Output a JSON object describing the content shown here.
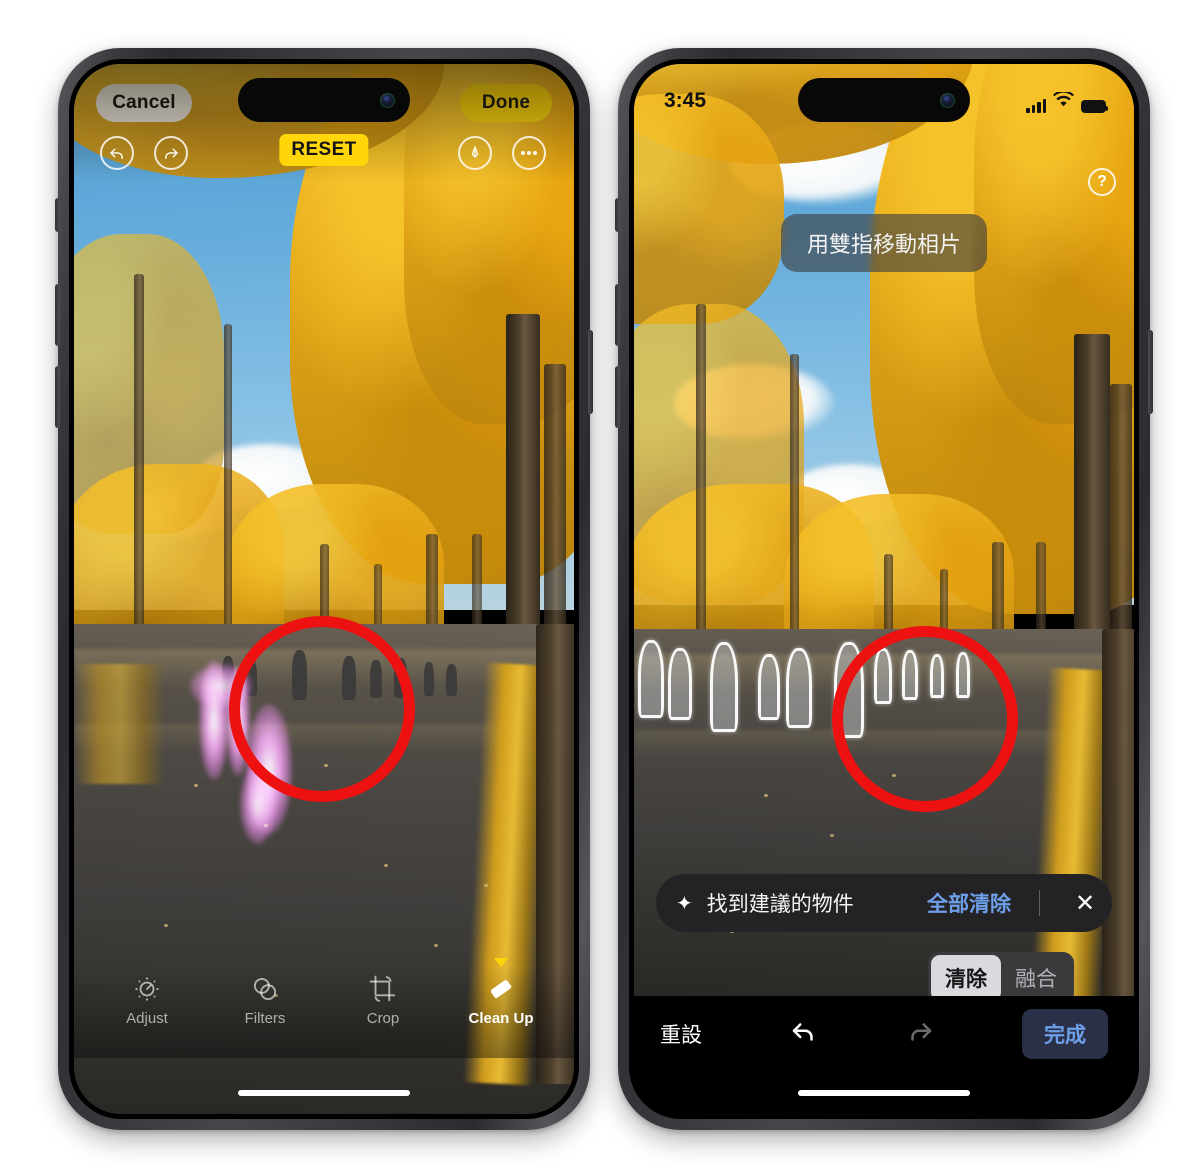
{
  "page": {
    "description": "Two iPhone screenshots side by side showing Apple Photos Clean Up editing of an autumn ginkgo tree-lined path",
    "background": "#ffffff"
  },
  "colors": {
    "accent_yellow": "#ffd60a",
    "accent_blue": "#6e9fe9",
    "annotation_red": "#ee1111",
    "brush_magenta": "#ff8cff",
    "sky_blue": "#63abdb",
    "foliage_gold": "#e0a316",
    "asphalt": "#403e3c"
  },
  "phone_left": {
    "name": "Photos editor - Clean Up brush applied",
    "topbar": {
      "cancel_label": "Cancel",
      "done_label": "Done",
      "undo_icon": "undo-arrow-icon",
      "redo_icon": "redo-arrow-icon",
      "reset_label": "RESET",
      "markup_icon": "markup-pen-icon",
      "more_icon": "more-ellipsis-icon"
    },
    "toolbar": {
      "items": [
        {
          "label": "Adjust",
          "icon": "adjust-dial-icon",
          "active": false
        },
        {
          "label": "Filters",
          "icon": "filters-circles-icon",
          "active": false
        },
        {
          "label": "Crop",
          "icon": "crop-frame-icon",
          "active": false
        },
        {
          "label": "Clean Up",
          "icon": "eraser-icon",
          "active": true
        }
      ]
    },
    "home_indicator": "home-indicator"
  },
  "phone_right": {
    "name": "Photos editor - Clean Up suggested objects detected",
    "statusbar": {
      "time": "3:45",
      "cellular_icon": "cellular-signal-icon",
      "wifi_icon": "wifi-icon",
      "battery_icon": "battery-icon"
    },
    "help_icon": "help-question-icon",
    "hint_toast": "用雙指移動相片",
    "suggestion_bar": {
      "sparkle_icon": "sparkles-icon",
      "text": "找到建議的物件",
      "clear_all_label": "全部清除",
      "close_icon": "close-x-icon"
    },
    "segmented_control": {
      "options": [
        {
          "label": "清除",
          "selected": true
        },
        {
          "label": "融合",
          "selected": false
        }
      ]
    },
    "toolbar": {
      "reset_label": "重設",
      "undo_icon": "undo-arrow-icon",
      "redo_icon": "redo-arrow-icon",
      "done_label": "完成"
    },
    "home_indicator": "home-indicator"
  }
}
